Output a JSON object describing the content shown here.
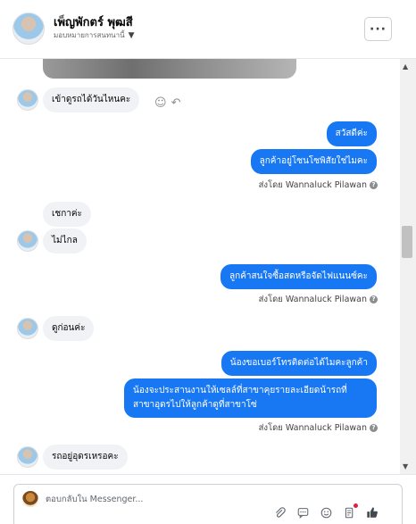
{
  "header": {
    "contact_name": "เพ็ญพักตร์ พุฒสี",
    "assign_label": "มอบหมายการสนทนานี้",
    "more_label": "···"
  },
  "messages": {
    "m1": "เข้าดูรถได้วันไหนคะ",
    "m2": "สวัสดีค่ะ",
    "m3": "ลูกค้าอยู่โซนโซพิสัยใช่ไมคะ",
    "m4": "เชกาค่ะ",
    "m5": "ไม่ไกล",
    "m6": "ลูกค้าสนใจซื้อสดหรือจัดไฟแนนซ์คะ",
    "m7": "ดูก่อนค่ะ",
    "m8": "น้องขอเบอร์โทรติดต่อได้ไมคะลูกค้า",
    "m9": "น้องจะประสานงานให้เซลล์ที่สาขาคุยรายละเอียดน้ารถที่สาขาอุดรไปให้ลูกค้าดูที่สาขาโซ่",
    "m10": "รถอยู่อุดรเหรอคะ"
  },
  "sent_by": "ส่งโดย Wannaluck Pilawan",
  "composer": {
    "placeholder": "ตอบกลับใน Messenger..."
  },
  "icons": {
    "react": "smile-icon",
    "reply": "reply-icon",
    "attach": "paperclip-icon",
    "saved_replies": "chat-icon",
    "emoji": "emoji-icon",
    "notes": "notes-icon",
    "like": "thumbs-up-icon"
  },
  "colors": {
    "outgoing_bubble": "#1877f2",
    "incoming_bubble": "#f0f2f5"
  }
}
